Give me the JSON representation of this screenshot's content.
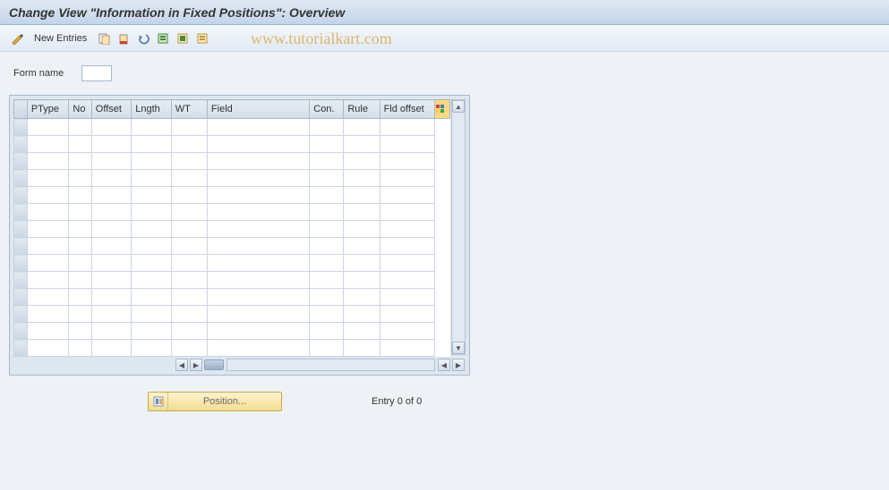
{
  "title": "Change View \"Information in Fixed Positions\": Overview",
  "toolbar": {
    "new_entries_label": "New Entries"
  },
  "watermark": "www.tutorialkart.com",
  "form": {
    "name_label": "Form name",
    "name_value": ""
  },
  "grid": {
    "columns": [
      "PType",
      "No",
      "Offset",
      "Lngth",
      "WT",
      "Field",
      "Con.",
      "Rule",
      "Fld offset"
    ],
    "num_empty_rows": 14
  },
  "footer": {
    "position_label": "Position...",
    "entry_text": "Entry 0 of 0"
  },
  "colors": {
    "title_bg_top": "#dfe9f5",
    "title_bg_bottom": "#c3d4e8",
    "config_header": "#fbd77f",
    "position_btn_bg": "#f5dd8f"
  }
}
